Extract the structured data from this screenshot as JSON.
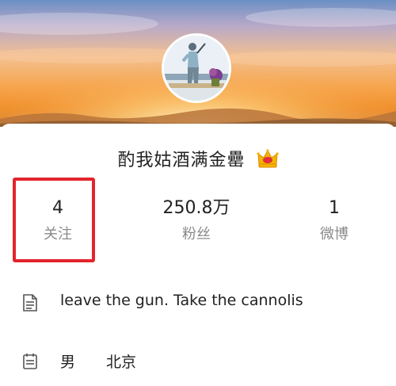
{
  "profile": {
    "nickname": "酌我姑酒满金罍",
    "badge_icon": "crown-icon",
    "avatar_icon": "golfer-photo"
  },
  "stats": [
    {
      "value": "4",
      "label": "关注"
    },
    {
      "value": "250.8万",
      "label": "粉丝"
    },
    {
      "value": "1",
      "label": "微博"
    }
  ],
  "info": {
    "bio": "leave the gun. Take the cannolis",
    "bio_icon": "document-icon",
    "gender": "男",
    "location": "北京",
    "details_icon": "calendar-icon"
  },
  "colors": {
    "highlight_border": "#e3242b",
    "crown_fill": "#f5b400",
    "crown_jewel": "#e0303a",
    "label_gray": "#8a8a8a",
    "text_dark": "#222222"
  }
}
